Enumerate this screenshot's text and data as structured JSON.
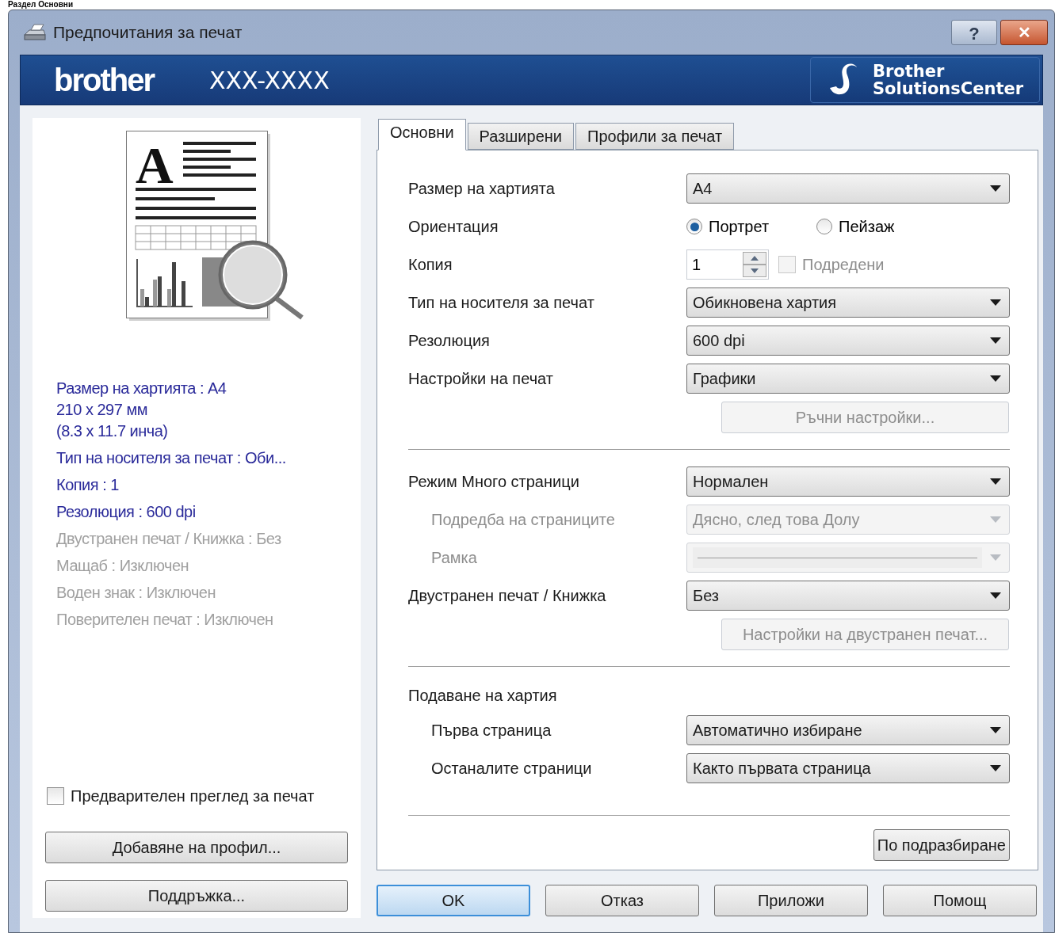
{
  "page_heading": "Раздел Основни",
  "preview_letter": "A",
  "window": {
    "title": "Предпочитания за печат",
    "help_button": "?",
    "close_button": "✕"
  },
  "banner": {
    "logo": "brother",
    "model": "XXX-XXXX",
    "solutions_center": [
      "Brother",
      "SolutionsCenter"
    ]
  },
  "summary": [
    {
      "lines": [
        "Размер на хартията : A4",
        "210 x 297 мм",
        "(8.3 x 11.7 инча)"
      ],
      "disabled": false
    },
    {
      "lines": [
        "Тип на носителя за печат : Оби..."
      ],
      "disabled": false
    },
    {
      "lines": [
        "Копия : 1"
      ],
      "disabled": false
    },
    {
      "lines": [
        "Резолюция : 600 dpi"
      ],
      "disabled": false
    },
    {
      "lines": [
        "Двустранен печат / Книжка : Без"
      ],
      "disabled": true
    },
    {
      "lines": [
        "Мащаб : Изключен"
      ],
      "disabled": true
    },
    {
      "lines": [
        "Воден знак : Изключен"
      ],
      "disabled": true
    },
    {
      "lines": [
        "Поверителен печат : Изключен"
      ],
      "disabled": true
    }
  ],
  "preview_checkbox": {
    "label": "Предварителен преглед за печат",
    "checked": false
  },
  "left_buttons": [
    "Добавяне на профил...",
    "Поддръжка..."
  ],
  "tabs": [
    {
      "label": "Основни",
      "selected": true
    },
    {
      "label": "Разширени",
      "selected": false
    },
    {
      "label": "Профили за печат",
      "selected": false
    }
  ],
  "rows": [
    {
      "kind": "dropdown",
      "label": "Размер на хартията",
      "value": "A4",
      "indent": false,
      "disabled": false
    },
    {
      "kind": "radio",
      "label": "Ориентация",
      "options": [
        {
          "label": "Портрет",
          "selected": true
        },
        {
          "label": "Пейзаж",
          "selected": false
        }
      ]
    },
    {
      "kind": "spinner",
      "label": "Копия",
      "value": "1",
      "checkbox": {
        "label": "Подредени",
        "checked": false,
        "disabled": true
      }
    },
    {
      "kind": "dropdown",
      "label": "Тип на носителя за печат",
      "value": "Обикновена хартия",
      "indent": false,
      "disabled": false
    },
    {
      "kind": "dropdown",
      "label": "Резолюция",
      "value": "600 dpi",
      "indent": false,
      "disabled": false
    },
    {
      "kind": "dropdown",
      "label": "Настройки на печат",
      "value": "Графики",
      "indent": false,
      "disabled": false
    },
    {
      "kind": "button",
      "label": "Ръчни настройки...",
      "disabled": true
    },
    {
      "kind": "separator"
    },
    {
      "kind": "dropdown",
      "label": "Режим Много страници",
      "value": "Нормален",
      "indent": false,
      "disabled": false
    },
    {
      "kind": "dropdown",
      "label": "Подредба на страниците",
      "value": "Дясно, след това Долу",
      "indent": true,
      "disabled": true
    },
    {
      "kind": "line",
      "label": "Рамка",
      "indent": true,
      "disabled": true
    },
    {
      "kind": "dropdown",
      "label": "Двустранен печат / Книжка",
      "value": "Без",
      "indent": false,
      "disabled": false
    },
    {
      "kind": "button",
      "label": "Настройки на двустранен печат...",
      "disabled": true
    },
    {
      "kind": "separator"
    },
    {
      "kind": "heading",
      "label": "Подаване на хартия"
    },
    {
      "kind": "dropdown",
      "label": "Първа страница",
      "value": "Автоматично избиране",
      "indent": true,
      "disabled": false
    },
    {
      "kind": "dropdown",
      "label": "Останалите страници",
      "value": "Както първата страница",
      "indent": true,
      "disabled": false
    }
  ],
  "default_button": "По подразбиране",
  "dialog_buttons": [
    {
      "label": "OK",
      "default": true
    },
    {
      "label": "Отказ",
      "default": false
    },
    {
      "label": "Приложи",
      "default": false
    },
    {
      "label": "Помощ",
      "default": false
    }
  ]
}
